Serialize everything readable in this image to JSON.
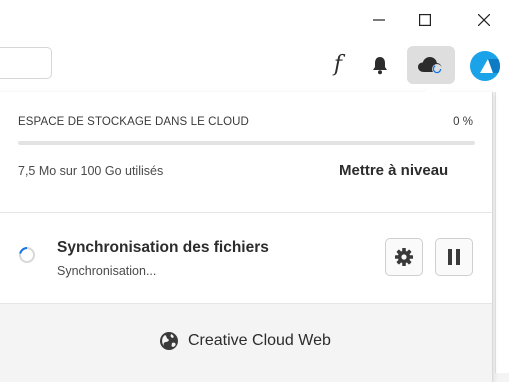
{
  "window": {
    "minimize_icon": "minimize-icon",
    "maximize_icon": "maximize-icon",
    "close_icon": "close-icon"
  },
  "toolbar": {
    "fonts_glyph": "f",
    "notifications_icon": "bell-icon",
    "cloud_icon": "cloud-sync-icon",
    "avatar_icon": "avatar"
  },
  "storage": {
    "title": "ESPACE DE STOCKAGE DANS LE CLOUD",
    "percent_label": "0 %",
    "used_fraction": 0.0,
    "used_label": "7,5 Mo sur 100 Go utilisés",
    "upgrade_label": "Mettre à niveau"
  },
  "sync": {
    "title": "Synchronisation des fichiers",
    "status": "Synchronisation...",
    "settings_icon": "gear-icon",
    "pause_icon": "pause-icon"
  },
  "footer": {
    "web_icon": "globe-icon",
    "web_label": "Creative Cloud Web"
  },
  "colors": {
    "accent": "#1473e6",
    "avatar": "#1aa3e8"
  }
}
